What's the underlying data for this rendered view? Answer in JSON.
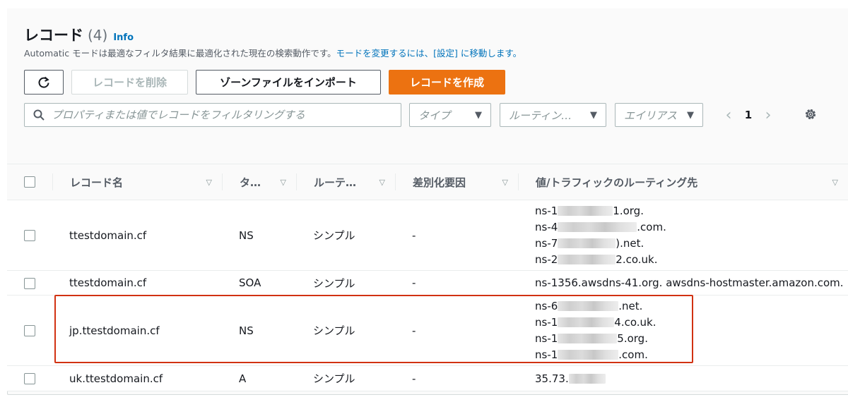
{
  "header": {
    "title": "レコード",
    "count": "(4)",
    "info_link": "Info",
    "description": "Automatic モードは最適なフィルタ結果に最適化された現在の検索動作です。",
    "description_link": "モードを変更するには、[設定] に移動します。"
  },
  "toolbar": {
    "refresh_icon": "refresh-icon",
    "delete_label": "レコードを削除",
    "import_label": "ゾーンファイルをインポート",
    "create_label": "レコードを作成"
  },
  "filters": {
    "search_placeholder": "プロパティまたは値でレコードをフィルタリングする",
    "type_label": "タイプ",
    "routing_label": "ルーティン…",
    "alias_label": "エイリアス"
  },
  "pagination": {
    "prev_icon": "chevron-left-icon",
    "current_page": "1",
    "next_icon": "chevron-right-icon",
    "settings_icon": "gear-icon"
  },
  "table": {
    "columns": [
      "レコード名",
      "タ…",
      "ルーテ…",
      "差別化要因",
      "値/トラフィックのルーティング先"
    ],
    "rows": [
      {
        "name": "ttestdomain.cf",
        "type": "NS",
        "routing": "シンプル",
        "differentiator": "-",
        "values": [
          {
            "prefix": "ns-1",
            "suffix": "1.org."
          },
          {
            "prefix": "ns-4",
            "suffix": ".com."
          },
          {
            "prefix": "ns-7",
            "suffix": ").net."
          },
          {
            "prefix": "ns-2",
            "suffix": "2.co.uk."
          }
        ]
      },
      {
        "name": "ttestdomain.cf",
        "type": "SOA",
        "routing": "シンプル",
        "differentiator": "-",
        "values": [
          {
            "prefix": "ns-1356.awsdns-41.org. awsdns-hostmaster.amazon.com.",
            "suffix": ""
          }
        ]
      },
      {
        "name": "jp.ttestdomain.cf",
        "type": "NS",
        "routing": "シンプル",
        "differentiator": "-",
        "values": [
          {
            "prefix": "ns-6",
            "suffix": ".net."
          },
          {
            "prefix": "ns-1",
            "suffix": "4.co.uk."
          },
          {
            "prefix": "ns-1",
            "suffix": "5.org."
          },
          {
            "prefix": "ns-1",
            "suffix": ".com."
          }
        ]
      },
      {
        "name": "uk.ttestdomain.cf",
        "type": "A",
        "routing": "シンプル",
        "differentiator": "-",
        "values": [
          {
            "prefix": "35.73.",
            "suffix": ""
          }
        ]
      }
    ]
  },
  "colors": {
    "primary": "#ec7211",
    "link": "#0073bb",
    "highlight_border": "#d13212"
  }
}
